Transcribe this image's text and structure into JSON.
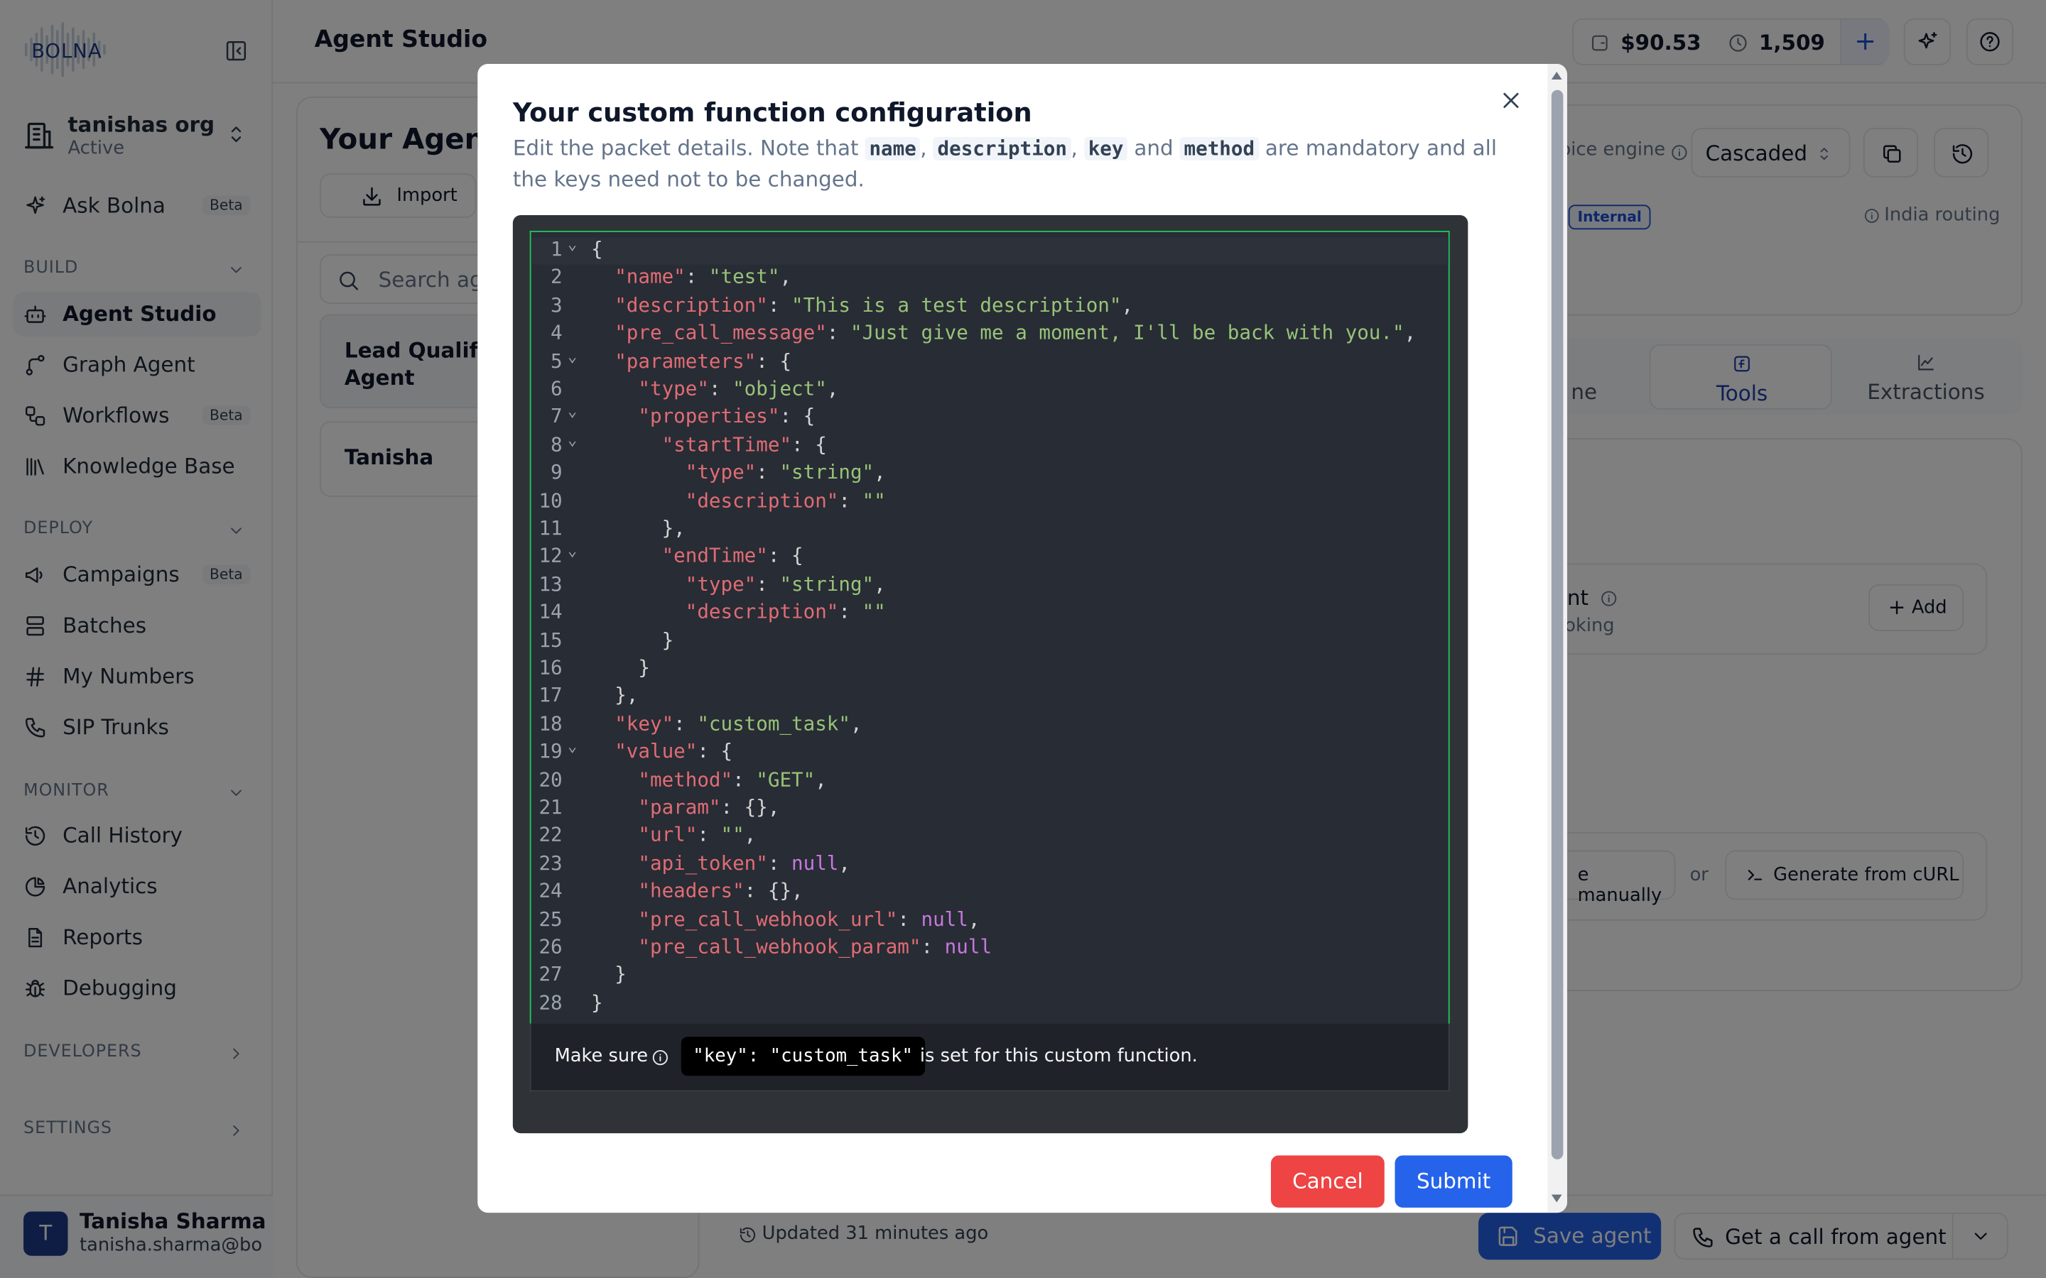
{
  "colors": {
    "primary": "#2563eb",
    "danger": "#ef4444",
    "editor_bg": "#282c34",
    "json_key": "#e06c75",
    "json_string": "#98c379",
    "json_null": "#c678dd",
    "focus_border": "#22c55e"
  },
  "app": {
    "logo_text": "BOLNA",
    "page_title": "Agent Studio"
  },
  "org": {
    "name": "tanishas org",
    "status": "Active"
  },
  "sidebar": {
    "ask": {
      "label": "Ask Bolna",
      "badge": "Beta"
    },
    "build_header": "BUILD",
    "build_items": [
      {
        "label": "Agent Studio",
        "icon": "bot-icon"
      },
      {
        "label": "Graph Agent",
        "icon": "graph-icon"
      },
      {
        "label": "Workflows",
        "badge": "Beta",
        "icon": "workflow-icon"
      },
      {
        "label": "Knowledge Base",
        "icon": "library-icon"
      }
    ],
    "deploy_header": "DEPLOY",
    "deploy_items": [
      {
        "label": "Campaigns",
        "badge": "Beta",
        "icon": "megaphone-icon"
      },
      {
        "label": "Batches",
        "icon": "batches-icon"
      },
      {
        "label": "My Numbers",
        "icon": "hash-icon"
      },
      {
        "label": "SIP Trunks",
        "icon": "phone-icon"
      }
    ],
    "monitor_header": "MONITOR",
    "monitor_items": [
      {
        "label": "Call History",
        "icon": "history-icon"
      },
      {
        "label": "Analytics",
        "icon": "chart-pie-icon"
      },
      {
        "label": "Reports",
        "icon": "report-icon"
      },
      {
        "label": "Debugging",
        "icon": "bug-icon"
      }
    ],
    "developers_header": "DEVELOPERS",
    "settings_header": "SETTINGS"
  },
  "user": {
    "initial": "T",
    "name": "Tanisha Sharma",
    "email": "tanisha.sharma@bolna"
  },
  "header": {
    "balance": "$90.53",
    "minutes": "1,509",
    "add": "+"
  },
  "agents_panel": {
    "title": "Your Agen",
    "import_label": "Import",
    "search_placeholder": "Search ag",
    "agents": [
      {
        "name": "Lead Qualifi Agent"
      },
      {
        "name": "Tanisha"
      }
    ],
    "updated": "Updated 31 minutes ago"
  },
  "agent_config": {
    "voice_engine_label": "pice engine",
    "voice_engine_value": "Cascaded",
    "internal_badge": "Internal",
    "routing": "India routing",
    "tabs": [
      {
        "label": "ne"
      },
      {
        "label": "Tools"
      },
      {
        "label": "Extractions"
      }
    ],
    "tool_title": "nt",
    "tool_subtitle": "oking",
    "add_label": "Add",
    "manual_label": "e manually",
    "or_label": "or",
    "curl_label": "Generate from cURL",
    "save_label": "Save agent",
    "call_label": "Get a call from agent"
  },
  "modal": {
    "title": "Your custom function configuration",
    "desc_1": "Edit the packet details. Note that",
    "desc_code_1": "name",
    "desc_comma_1": ",",
    "desc_code_2": "description",
    "desc_comma_2": ",",
    "desc_code_3": "key",
    "desc_and": "and",
    "desc_code_4": "method",
    "desc_2": "are mandatory and all the keys need not to be changed.",
    "code_lines": [
      [
        [
          "p",
          "{"
        ]
      ],
      [
        [
          "p",
          "  "
        ],
        [
          "k",
          "\"name\""
        ],
        [
          "p",
          ": "
        ],
        [
          "s",
          "\"test\""
        ],
        [
          "p",
          ","
        ]
      ],
      [
        [
          "p",
          "  "
        ],
        [
          "k",
          "\"description\""
        ],
        [
          "p",
          ": "
        ],
        [
          "s",
          "\"This is a test description\""
        ],
        [
          "p",
          ","
        ]
      ],
      [
        [
          "p",
          "  "
        ],
        [
          "k",
          "\"pre_call_message\""
        ],
        [
          "p",
          ": "
        ],
        [
          "s",
          "\"Just give me a moment, I'll be back with you.\""
        ],
        [
          "p",
          ","
        ]
      ],
      [
        [
          "p",
          "  "
        ],
        [
          "k",
          "\"parameters\""
        ],
        [
          "p",
          ": {"
        ]
      ],
      [
        [
          "p",
          "    "
        ],
        [
          "k",
          "\"type\""
        ],
        [
          "p",
          ": "
        ],
        [
          "s",
          "\"object\""
        ],
        [
          "p",
          ","
        ]
      ],
      [
        [
          "p",
          "    "
        ],
        [
          "k",
          "\"properties\""
        ],
        [
          "p",
          ": {"
        ]
      ],
      [
        [
          "p",
          "      "
        ],
        [
          "k",
          "\"startTime\""
        ],
        [
          "p",
          ": {"
        ]
      ],
      [
        [
          "p",
          "        "
        ],
        [
          "k",
          "\"type\""
        ],
        [
          "p",
          ": "
        ],
        [
          "s",
          "\"string\""
        ],
        [
          "p",
          ","
        ]
      ],
      [
        [
          "p",
          "        "
        ],
        [
          "k",
          "\"description\""
        ],
        [
          "p",
          ": "
        ],
        [
          "s",
          "\"\""
        ]
      ],
      [
        [
          "p",
          "      },"
        ]
      ],
      [
        [
          "p",
          "      "
        ],
        [
          "k",
          "\"endTime\""
        ],
        [
          "p",
          ": {"
        ]
      ],
      [
        [
          "p",
          "        "
        ],
        [
          "k",
          "\"type\""
        ],
        [
          "p",
          ": "
        ],
        [
          "s",
          "\"string\""
        ],
        [
          "p",
          ","
        ]
      ],
      [
        [
          "p",
          "        "
        ],
        [
          "k",
          "\"description\""
        ],
        [
          "p",
          ": "
        ],
        [
          "s",
          "\"\""
        ]
      ],
      [
        [
          "p",
          "      }"
        ]
      ],
      [
        [
          "p",
          "    }"
        ]
      ],
      [
        [
          "p",
          "  },"
        ]
      ],
      [
        [
          "p",
          "  "
        ],
        [
          "k",
          "\"key\""
        ],
        [
          "p",
          ": "
        ],
        [
          "s",
          "\"custom_task\""
        ],
        [
          "p",
          ","
        ]
      ],
      [
        [
          "p",
          "  "
        ],
        [
          "k",
          "\"value\""
        ],
        [
          "p",
          ": {"
        ]
      ],
      [
        [
          "p",
          "    "
        ],
        [
          "k",
          "\"method\""
        ],
        [
          "p",
          ": "
        ],
        [
          "s",
          "\"GET\""
        ],
        [
          "p",
          ","
        ]
      ],
      [
        [
          "p",
          "    "
        ],
        [
          "k",
          "\"param\""
        ],
        [
          "p",
          ": {},"
        ]
      ],
      [
        [
          "p",
          "    "
        ],
        [
          "k",
          "\"url\""
        ],
        [
          "p",
          ": "
        ],
        [
          "s",
          "\"\""
        ],
        [
          "p",
          ","
        ]
      ],
      [
        [
          "p",
          "    "
        ],
        [
          "k",
          "\"api_token\""
        ],
        [
          "p",
          ": "
        ],
        [
          "n",
          "null"
        ],
        [
          "p",
          ","
        ]
      ],
      [
        [
          "p",
          "    "
        ],
        [
          "k",
          "\"headers\""
        ],
        [
          "p",
          ": {},"
        ]
      ],
      [
        [
          "p",
          "    "
        ],
        [
          "k",
          "\"pre_call_webhook_url\""
        ],
        [
          "p",
          ": "
        ],
        [
          "n",
          "null"
        ],
        [
          "p",
          ","
        ]
      ],
      [
        [
          "p",
          "    "
        ],
        [
          "k",
          "\"pre_call_webhook_param\""
        ],
        [
          "p",
          ": "
        ],
        [
          "n",
          "null"
        ]
      ],
      [
        [
          "p",
          "  }"
        ]
      ],
      [
        [
          "p",
          "}"
        ]
      ]
    ],
    "foldable_lines": [
      1,
      5,
      7,
      8,
      12,
      19
    ],
    "footer_prefix": "Make sure",
    "footer_code": "\"key\": \"custom_task\"",
    "footer_suffix": "is set for this custom function.",
    "cancel_label": "Cancel",
    "submit_label": "Submit"
  }
}
